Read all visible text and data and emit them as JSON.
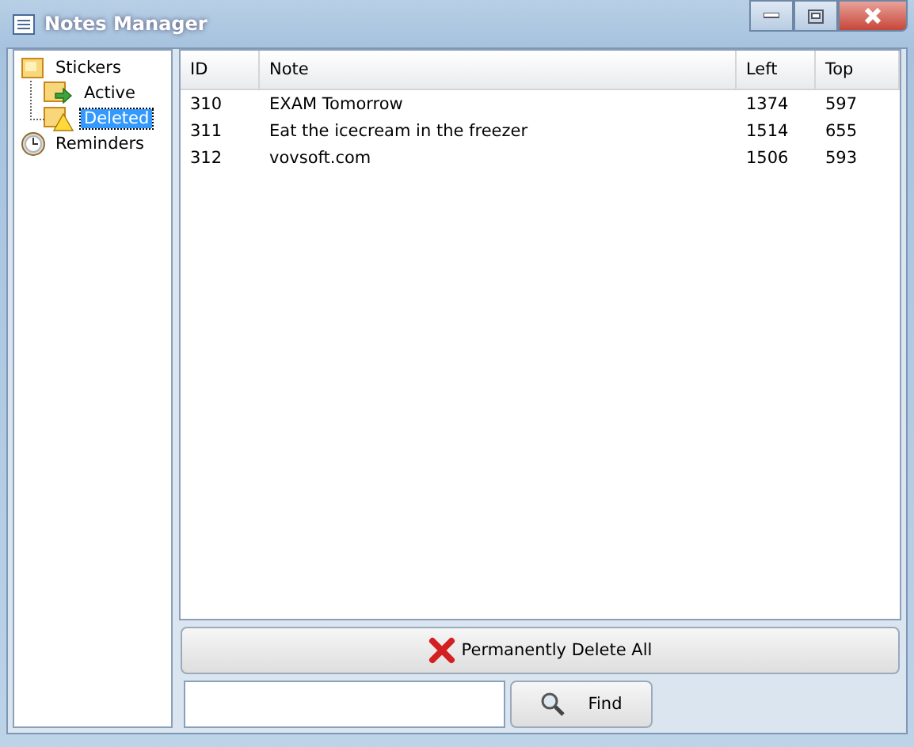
{
  "window": {
    "title": "Notes Manager"
  },
  "tree": [
    {
      "label": "Stickers",
      "kind": "folder",
      "selected": false,
      "children": [
        {
          "label": "Active",
          "kind": "active",
          "selected": false
        },
        {
          "label": "Deleted",
          "kind": "deleted",
          "selected": true
        }
      ]
    },
    {
      "label": "Reminders",
      "kind": "clock",
      "selected": false
    }
  ],
  "table": {
    "columns": [
      "ID",
      "Note",
      "Left",
      "Top"
    ],
    "rows": [
      [
        "310",
        "EXAM Tomorrow",
        "1374",
        "597"
      ],
      [
        "311",
        "Eat the icecream in the freezer",
        "1514",
        "655"
      ],
      [
        "312",
        "vovsoft.com",
        "1506",
        "593"
      ]
    ]
  },
  "delete_button": "Permanently Delete All",
  "find": {
    "button": "Find"
  }
}
